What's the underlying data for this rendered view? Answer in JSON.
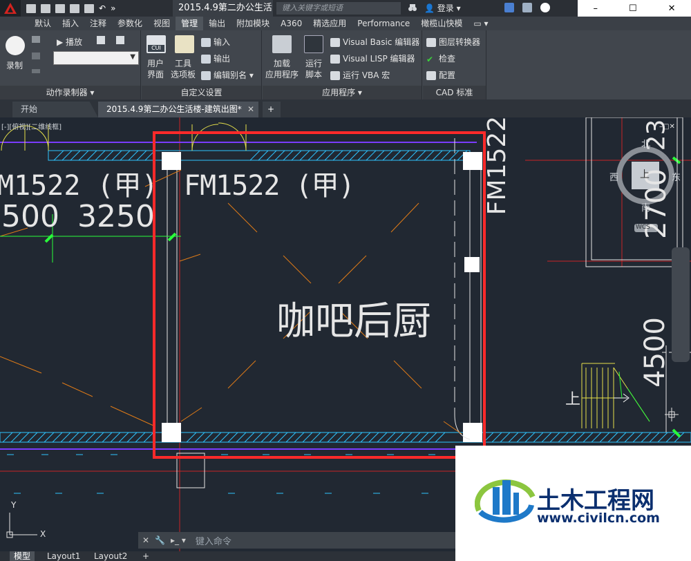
{
  "titlebar": {
    "document_title": "2015.4.9第二办公生活...",
    "search_placeholder": "键入关键字或短语",
    "login_label": "登录",
    "window_controls": [
      "–",
      "☐",
      "✕"
    ]
  },
  "menu_tabs": [
    "默认",
    "插入",
    "注释",
    "参数化",
    "视图",
    "管理",
    "输出",
    "附加模块",
    "A360",
    "精选应用",
    "Performance",
    "橄榄山快模"
  ],
  "active_menu_tab": "管理",
  "ribbon": {
    "action_recorder": {
      "record_label": "录制",
      "play_label": "播放",
      "panel_title": "动作录制器 ▾"
    },
    "customization": {
      "cui_label": "CUI",
      "user_interface_line1": "用户",
      "user_interface_line2": "界面",
      "tool_palettes_line1": "工具",
      "tool_palettes_line2": "选项板",
      "import_label": "输入",
      "export_label": "输出",
      "edit_aliases_label": "编辑别名 ▾",
      "panel_title": "自定义设置"
    },
    "applications": {
      "load_app_line1": "加载",
      "load_app_line2": "应用程序",
      "run_script_line1": "运行",
      "run_script_line2": "脚本",
      "vb_editor_label": "Visual Basic 编辑器",
      "lisp_editor_label": "Visual LISP 编辑器",
      "run_vba_label": "运行 VBA 宏",
      "panel_title": "应用程序 ▾"
    },
    "cad_standards": {
      "layer_translator_label": "图层转换器",
      "check_label": "检查",
      "configure_label": "配置",
      "panel_title": "CAD 标准"
    }
  },
  "doc_tabs": {
    "start_label": "开始",
    "active_doc_label": "2015.4.9第二办公生活楼-建筑出图*",
    "add_label": "+"
  },
  "canvas": {
    "view_label": "[-][俯视][二维线框]",
    "texts": {
      "door_left": "M1522 (甲)",
      "door_center": "FM1522 (甲)",
      "dim_left": "500",
      "dim_3250": "3250",
      "room_label": "咖吧后厨",
      "door_vertical": "FM1522",
      "dim_2700": "2700",
      "dim_23": "23",
      "dim_4500": "4500",
      "stair_label": "上",
      "compass_north": "北",
      "compass_south": "南",
      "compass_east": "东",
      "compass_west": "西",
      "compass_center": "上",
      "wcs_label": "WCS",
      "ucs_y": "Y",
      "ucs_x": "X"
    }
  },
  "command_line": {
    "placeholder": "键入命令"
  },
  "layout_tabs": [
    "模型",
    "Layout1",
    "Layout2"
  ],
  "layout_add_label": "+",
  "watermark": {
    "brand_cn": "土木工程网",
    "url": "www.civilcn.com"
  },
  "colors": {
    "highlight": "#ff2a2a",
    "hatch": "#2ec4ff",
    "wall_purple": "#7a3cff",
    "door_yellow": "#e7e14a",
    "grid_red": "#d92a2a",
    "green_mark": "#29ff3a",
    "orange_diag": "#e07b17"
  }
}
